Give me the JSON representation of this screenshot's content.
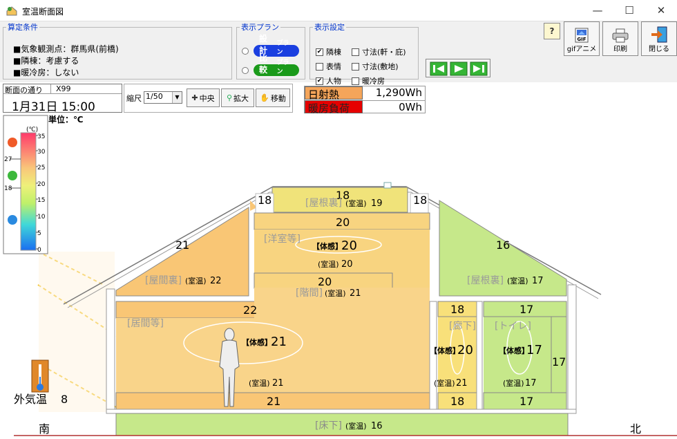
{
  "window": {
    "title": "室温断面図"
  },
  "conditions": {
    "legend": "算定条件",
    "lines": [
      "■気象観測点：群馬県(前橋)",
      "■隣棟：考慮する",
      "■暖冷房：しない"
    ]
  },
  "plan": {
    "legend": "表示プラン",
    "design": {
      "label": "設計",
      "suffix": "プラン",
      "color": "#1a3fe0"
    },
    "compare": {
      "label": "比較",
      "suffix": "プラン",
      "color": "#1a9a1a"
    }
  },
  "display": {
    "legend": "表示設定",
    "options": [
      {
        "label": "隣棟",
        "checked": true
      },
      {
        "label": "寸法(軒・庇)",
        "checked": false
      },
      {
        "label": "表情",
        "checked": false
      },
      {
        "label": "寸法(敷地)",
        "checked": false
      },
      {
        "label": "人物",
        "checked": true
      },
      {
        "label": "暖冷房",
        "checked": false
      }
    ]
  },
  "toolbar": {
    "help": "?",
    "gif": "gifアニメ",
    "print": "印刷",
    "close": "閉じる"
  },
  "section": {
    "label": "断面の通り",
    "value": "X99",
    "datetime": "1月31日 15:00"
  },
  "zoom": {
    "label": "縮尺",
    "value": "1/50",
    "center": "中央",
    "enlarge": "拡大",
    "move": "移動"
  },
  "energy": {
    "solar_label": "日射熱",
    "solar_value": "1,290Wh",
    "solar_color": "#f5a55a",
    "heat_label": "暖房負荷",
    "heat_value": "0Wh",
    "heat_color": "#e60000"
  },
  "scale": {
    "unit": "単位：℃",
    "unit_symbol": "(℃)",
    "ticks": [
      "35",
      "30",
      "25",
      "20",
      "15",
      "10",
      "5",
      "0"
    ],
    "markers": [
      "27",
      "18"
    ]
  },
  "section_view": {
    "roof_left": "21",
    "roof_right": "16",
    "attic_top": "18",
    "attic_top_left": "18",
    "attic_top_right": "18",
    "attic_label": "[屋根裏]",
    "attic_room": "(室温)",
    "attic_temp": "19",
    "ceiling_upper": "20",
    "western_label": "[洋室等]",
    "western_feel_label": "【体感】",
    "western_feel": "20",
    "western_room": "(室温)",
    "western_temp": "20",
    "floor2": "20",
    "stairs_label": "[階間]",
    "stairs_room": "(室温)",
    "stairs_temp": "21",
    "left_attic_label": "[屋間裏]",
    "left_attic_room": "(室温)",
    "left_attic_temp": "22",
    "right_attic_label": "[屋根裏]",
    "right_attic_room": "(室温)",
    "right_attic_temp": "17",
    "ceiling1": "22",
    "living_label": "[居間等]",
    "living_feel_label": "【体感】",
    "living_feel": "21",
    "living_room": "(室温)",
    "living_temp": "21",
    "living_floor": "21",
    "hall_top": "18",
    "hall_label": "[廊下]",
    "hall_feel_label": "【体感】",
    "hall_feel": "20",
    "hall_room": "(室温)",
    "hall_temp": "21",
    "hall_floor": "18",
    "toilet_top": "17",
    "toilet_label": "[トイレ]",
    "toilet_feel_label": "【体感】",
    "toilet_feel": "17",
    "toilet_room": "(室温)",
    "toilet_temp": "17",
    "toilet_side": "17",
    "toilet_floor": "17",
    "underfloor_label": "[床下]",
    "underfloor_room": "(室温)",
    "underfloor_temp": "16",
    "outside_label": "外気温",
    "outside_temp": "8",
    "south": "南",
    "north": "北"
  }
}
